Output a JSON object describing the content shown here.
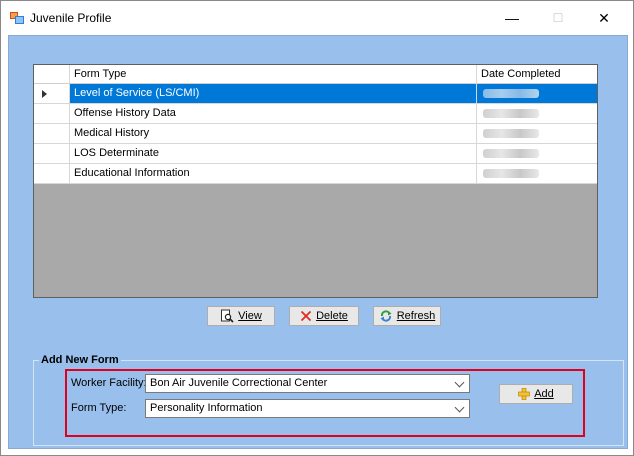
{
  "window": {
    "title": "Juvenile Profile",
    "minimize": "—",
    "maximize": "☐",
    "close": "✕"
  },
  "grid": {
    "columns": [
      "Form Type",
      "Date Completed"
    ],
    "rows": [
      {
        "form_type": "Level of Service (LS/CMI)",
        "selected": true
      },
      {
        "form_type": "Offense History Data",
        "selected": false
      },
      {
        "form_type": "Medical History",
        "selected": false
      },
      {
        "form_type": "LOS Determinate",
        "selected": false
      },
      {
        "form_type": "Educational Information",
        "selected": false
      }
    ]
  },
  "actions": {
    "view": "View",
    "delete": "Delete",
    "refresh": "Refresh"
  },
  "add_form": {
    "group_title": "Add New Form",
    "worker_facility_label": "Worker Facility:",
    "worker_facility_value": "Bon Air Juvenile Correctional Center",
    "form_type_label": "Form Type:",
    "form_type_value": "Personality Information",
    "add_button": "Add"
  },
  "colors": {
    "client_bg": "#99bfec",
    "selection": "#0078d7",
    "highlight_border": "#e0001b"
  }
}
